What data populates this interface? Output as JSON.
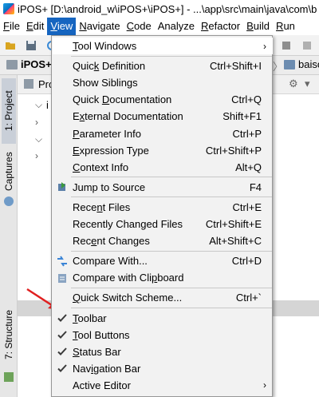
{
  "window": {
    "title": "iPOS+ [D:\\android_w\\iPOS+\\iPOS+] - ...\\app\\src\\main\\java\\com\\b"
  },
  "menubar": [
    {
      "label": "File",
      "mnemonic": "F",
      "rest": "ile"
    },
    {
      "label": "Edit",
      "mnemonic": "E",
      "rest": "dit"
    },
    {
      "label": "View",
      "mnemonic": "V",
      "rest": "iew"
    },
    {
      "label": "Navigate",
      "mnemonic": "N",
      "rest": "avigate"
    },
    {
      "label": "Code",
      "mnemonic": "C",
      "rest": "ode"
    },
    {
      "label": "Analyze",
      "mnemonic": "",
      "rest": "Analyze"
    },
    {
      "label": "Refactor",
      "mnemonic": "R",
      "rest": "efactor"
    },
    {
      "label": "Build",
      "mnemonic": "B",
      "rest": "uild"
    },
    {
      "label": "Run",
      "mnemonic": "R",
      "rest": "un"
    }
  ],
  "navbar": {
    "crumb1": "iPOS+",
    "crumb2": "baiso"
  },
  "project_panel": {
    "header": "Pro",
    "root_label": "i"
  },
  "left_strip": {
    "project_tab": "1: Project",
    "captures_tab": "Captures",
    "structure_tab": "7: Structure"
  },
  "view_menu": {
    "items": [
      {
        "type": "item",
        "label": "Tool Windows",
        "mnemonic_index": 0,
        "submenu": true,
        "icon": ""
      },
      {
        "type": "sep"
      },
      {
        "type": "item",
        "label": "Quick Definition",
        "shortcut": "Ctrl+Shift+I",
        "mnemonic_index": 4,
        "icon": ""
      },
      {
        "type": "item",
        "label": "Show Siblings",
        "shortcut": "",
        "icon": ""
      },
      {
        "type": "item",
        "label": "Quick Documentation",
        "shortcut": "Ctrl+Q",
        "mnemonic_index": 6,
        "icon": ""
      },
      {
        "type": "item",
        "label": "External Documentation",
        "shortcut": "Shift+F1",
        "mnemonic_index": 1,
        "icon": ""
      },
      {
        "type": "item",
        "label": "Parameter Info",
        "shortcut": "Ctrl+P",
        "mnemonic_index": 0,
        "icon": ""
      },
      {
        "type": "item",
        "label": "Expression Type",
        "shortcut": "Ctrl+Shift+P",
        "mnemonic_index": 0,
        "icon": ""
      },
      {
        "type": "item",
        "label": "Context Info",
        "shortcut": "Alt+Q",
        "mnemonic_index": 0,
        "icon": ""
      },
      {
        "type": "sep"
      },
      {
        "type": "item",
        "label": "Jump to Source",
        "shortcut": "F4",
        "mnemonic_index": -1,
        "icon": "jump-to-source-icon"
      },
      {
        "type": "sep"
      },
      {
        "type": "item",
        "label": "Recent Files",
        "shortcut": "Ctrl+E",
        "mnemonic_index": 4,
        "icon": ""
      },
      {
        "type": "item",
        "label": "Recently Changed Files",
        "shortcut": "Ctrl+Shift+E",
        "mnemonic_index": -1,
        "icon": ""
      },
      {
        "type": "item",
        "label": "Recent Changes",
        "shortcut": "Alt+Shift+C",
        "mnemonic_index": 3,
        "icon": ""
      },
      {
        "type": "sep"
      },
      {
        "type": "item",
        "label": "Compare With...",
        "shortcut": "Ctrl+D",
        "mnemonic_index": -1,
        "icon": "compare-icon"
      },
      {
        "type": "item",
        "label": "Compare with Clipboard",
        "shortcut": "",
        "mnemonic_index": 16,
        "icon": "compare-clipboard-icon"
      },
      {
        "type": "sep"
      },
      {
        "type": "item",
        "label": "Quick Switch Scheme...",
        "shortcut": "Ctrl+`",
        "mnemonic_index": 0,
        "icon": ""
      },
      {
        "type": "sep"
      },
      {
        "type": "item",
        "label": "Toolbar",
        "shortcut": "",
        "mnemonic_index": 0,
        "checked": true,
        "icon": "check-icon"
      },
      {
        "type": "item",
        "label": "Tool Buttons",
        "shortcut": "",
        "mnemonic_index": 0,
        "checked": true,
        "icon": "check-icon"
      },
      {
        "type": "item",
        "label": "Status Bar",
        "shortcut": "",
        "mnemonic_index": 0,
        "checked": true,
        "icon": "check-icon"
      },
      {
        "type": "item",
        "label": "Navigation Bar",
        "shortcut": "",
        "mnemonic_index": 3,
        "checked": true,
        "icon": "check-icon"
      },
      {
        "type": "item",
        "label": "Active Editor",
        "shortcut": "",
        "mnemonic_index": -1,
        "submenu": true,
        "icon": ""
      }
    ],
    "hovered_item": "Tool Windows"
  },
  "colors": {
    "menubar_active": "#1665c0",
    "arrow_red": "#e02020",
    "check": "#3a3a3a"
  }
}
